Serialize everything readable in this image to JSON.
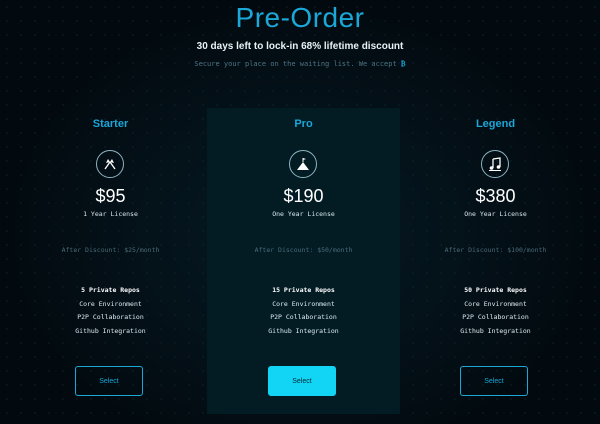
{
  "header": {
    "title": "Pre-Order",
    "subtitle": "30 days left to lock-in 68% lifetime discount",
    "secure_text": "Secure your place on the waiting list. We accept",
    "accept_symbol": "₿"
  },
  "plans": [
    {
      "name": "Starter",
      "icon": "crossed-flags-icon",
      "price": "$95",
      "license": "1 Year License",
      "discount": "After Discount: $25/month",
      "features": [
        "5 Private Repos",
        "Core Environment",
        "P2P Collaboration",
        "Github Integration"
      ],
      "button": "Select"
    },
    {
      "name": "Pro",
      "icon": "mountain-flag-icon",
      "price": "$190",
      "license": "One Year License",
      "discount": "After Discount: $50/month",
      "features": [
        "15 Private Repos",
        "Core Environment",
        "P2P Collaboration",
        "Github Integration"
      ],
      "button": "Select"
    },
    {
      "name": "Legend",
      "icon": "music-note-icon",
      "price": "$380",
      "license": "One Year License",
      "discount": "After Discount: $100/month",
      "features": [
        "50 Private Repos",
        "Core Environment",
        "P2P Collaboration",
        "Github Integration"
      ],
      "button": "Select"
    }
  ],
  "colors": {
    "accent": "#1ba7d8",
    "primary_button": "#12d4f5",
    "background": "#020a0f",
    "highlight_panel": "#031c24"
  }
}
